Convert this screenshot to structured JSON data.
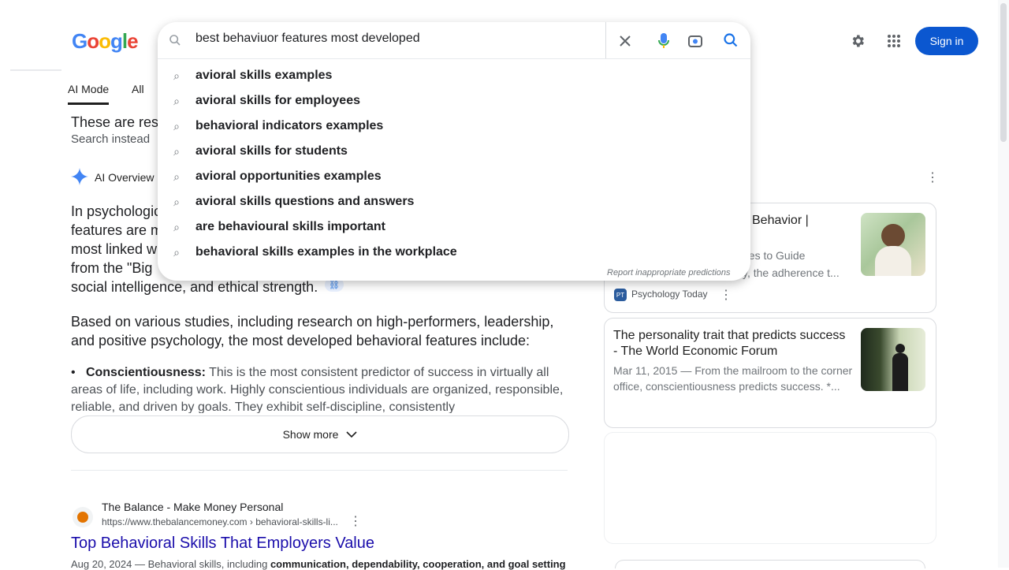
{
  "header": {
    "logo_letters": [
      "G",
      "o",
      "o",
      "g",
      "l",
      "e"
    ],
    "settings_icon": "gear-icon",
    "apps_icon": "apps-grid-icon",
    "signin_label": "Sign in"
  },
  "search": {
    "query": "best behaviuor features most developed",
    "clear_icon": "close-icon",
    "voice_icon": "microphone-icon",
    "lens_icon": "camera-lens-icon",
    "search_icon": "search-icon",
    "suggestions": [
      "behavioral skills examples",
      "behavioral skills for employees",
      "behavioral indicators examples",
      "behavioral skills for students",
      "behavioral opportunities examples",
      "behavioral skills questions and answers",
      "why are behavioural skills important",
      "behavioral skills examples in the workplace"
    ],
    "suggestion_visible": [
      "avioral skills examples",
      "avioral skills for employees",
      "behavioral indicators examples",
      "avioral skills for students",
      "avioral opportunities examples",
      "avioral skills questions and answers",
      "are behavioural skills important",
      "behavioral skills examples in the workplace"
    ],
    "report_link": "Report inappropriate predictions"
  },
  "tabs": [
    "AI Mode",
    "All"
  ],
  "main": {
    "notice_line1": "These are res",
    "notice_line2": "Search instead",
    "ai_overview_label": "AI Overview",
    "para1_lines": [
      "In psychologic",
      "features are m",
      "most linked w",
      "from the \"Big",
      "social intelligence, and ethical strength."
    ],
    "para2": "Based on various studies, including research on high-performers, leadership, and positive psychology, the most developed behavioral features include:",
    "bullet_term": "Conscientiousness:",
    "bullet_text": " This is the most consistent predictor of success in virtually all areas of life, including work. Highly conscientious individuals are organized, responsible, reliable, and driven by goals. They exhibit self-discipline, consistently",
    "show_more": "Show more",
    "result": {
      "site": "The Balance - Make Money Personal",
      "url": "https://www.thebalancemoney.com › behavioral-skills-li...",
      "title": "Top Behavioral Skills That Employers Value",
      "date": "Aug 20, 2024",
      "snippet_plain": " — Behavioral skills, including ",
      "snippet_bold": "communication, dependability, cooperation, and goal setting"
    }
  },
  "cards": [
    {
      "title_visible": "Behavior |",
      "snippet_visible1": "ues to Guide",
      "snippet_visible2": "y, the adherence t...",
      "source": "Psychology Today",
      "source_initial": "PT",
      "accent": "#2b5c9e"
    },
    {
      "title": "The personality trait that predicts success - The World Economic Forum",
      "date": "Mar 11, 2015",
      "snippet": " — From the mailroom to the corner office, conscientiousness predicts success. *..."
    }
  ],
  "colors": {
    "signin_bg": "#0b57d0",
    "link": "#1a0dab",
    "ai_star": "#4285f4"
  }
}
